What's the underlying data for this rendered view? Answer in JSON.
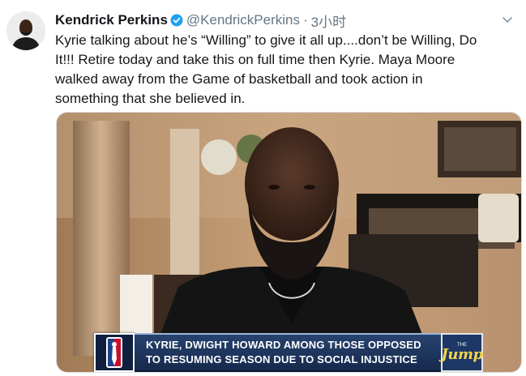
{
  "tweet": {
    "author_name": "Kendrick Perkins",
    "handle": "@KendrickPerkins",
    "separator": "·",
    "time": "3小时",
    "verified_icon": "verified-badge-icon",
    "menu_icon": "chevron-down-icon",
    "text": "Kyrie talking about he’s “Willing” to give it all up....don’t be Willing, Do\nIt!!! Retire today and take this on full time then Kyrie. Maya Moore\nwalked away from the Game of basketball and took action in\nsomething that she believed in."
  },
  "media": {
    "banner_line1": "KYRIE, DWIGHT HOWARD AMONG THOSE OPPOSED",
    "banner_line2": "TO RESUMING SEASON DUE TO SOCIAL INJUSTICE",
    "jump_small": "THE",
    "jump_logo": "Jump",
    "league_logo_icon": "nba-logo-icon"
  },
  "colors": {
    "verified": "#1da1f2",
    "secondary_text": "#657786",
    "banner_blue": "#27436f",
    "jump_yellow": "#f2d44a"
  }
}
